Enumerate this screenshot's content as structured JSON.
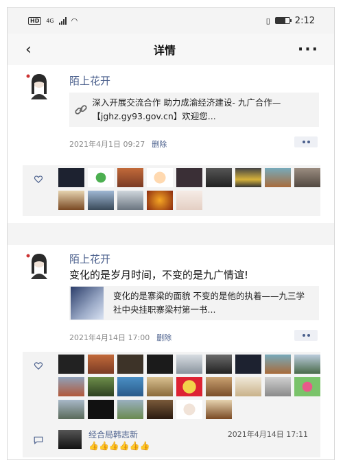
{
  "status": {
    "time": "2:12",
    "net": "HD",
    "sig": "4G"
  },
  "nav": {
    "title": "详情"
  },
  "posts": [
    {
      "author": "陌上花开",
      "link_text": "深入开展交流合作 助力成渝经济建设- 九广合作—【jghz.gy93.gov.cn】欢迎您...",
      "time": "2021年4月1日 09:27",
      "delete": "删除"
    },
    {
      "author": "陌上花开",
      "text": "变化的是岁月时间，不变的是九广情谊!",
      "link_text": "变化的是寨梁的面貌 不变的是他的执着——九三学社中央挂职寨梁村第一书...",
      "time": "2021年4月14日 17:00",
      "delete": "删除"
    }
  ],
  "comment": {
    "author": "经合局韩志新",
    "time": "2021年4月14日 17:11",
    "text": "👍👍👍👍👍👍"
  },
  "colors": {
    "accent": "#4a5f8c",
    "bg": "#f4f4f4",
    "panel": "#f3f3f3"
  },
  "icons": {
    "back": "chevron-left-icon",
    "more": "more-dots-icon",
    "link": "link-icon",
    "like": "heart-icon",
    "comment": "comment-icon"
  }
}
